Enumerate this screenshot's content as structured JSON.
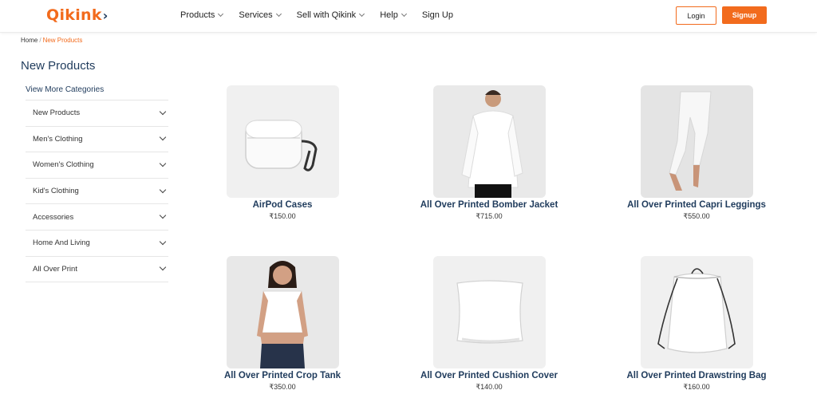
{
  "header": {
    "logo": "Qikink",
    "nav": [
      {
        "label": "Products",
        "dropdown": true
      },
      {
        "label": "Services",
        "dropdown": true
      },
      {
        "label": "Sell with Qikink",
        "dropdown": true
      },
      {
        "label": "Help",
        "dropdown": true
      },
      {
        "label": "Sign Up",
        "dropdown": false
      }
    ],
    "login_label": "Login",
    "signup_label": "Signup",
    "accent_color": "#f26b1d",
    "brand_navy": "#1f3b5c"
  },
  "breadcrumb": {
    "home": "Home",
    "separator": "/",
    "current": "New Products"
  },
  "sidebar": {
    "title": "New Products",
    "view_more": "View More Categories",
    "categories": [
      {
        "label": "New Products",
        "icon": "chevron-down-icon"
      },
      {
        "label": "Men's Clothing",
        "icon": "chevron-down-icon"
      },
      {
        "label": "Women's Clothing",
        "icon": "chevron-down-icon"
      },
      {
        "label": "Kid's Clothing",
        "icon": "chevron-down-icon"
      },
      {
        "label": "Accessories",
        "icon": "chevron-down-icon"
      },
      {
        "label": "Home And Living",
        "icon": "chevron-down-icon"
      },
      {
        "label": "All Over Print",
        "icon": "chevron-down-icon"
      }
    ]
  },
  "products": [
    {
      "name": "AirPod Cases",
      "price": "₹150.00",
      "image": "airpod-case-image"
    },
    {
      "name": "All Over Printed Bomber Jacket",
      "price": "₹715.00",
      "image": "bomber-jacket-image"
    },
    {
      "name": "All Over Printed Capri Leggings",
      "price": "₹550.00",
      "image": "capri-leggings-image"
    },
    {
      "name": "All Over Printed Crop Tank",
      "price": "₹350.00",
      "image": "crop-tank-image"
    },
    {
      "name": "All Over Printed Cushion Cover",
      "price": "₹140.00",
      "image": "cushion-cover-image"
    },
    {
      "name": "All Over Printed Drawstring Bag",
      "price": "₹160.00",
      "image": "drawstring-bag-image"
    }
  ]
}
